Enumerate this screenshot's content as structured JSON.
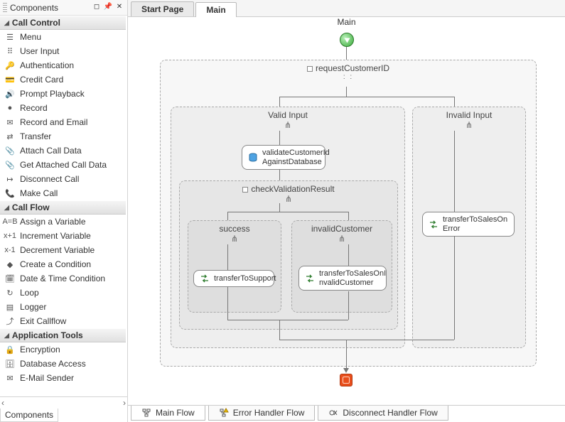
{
  "sidebar": {
    "title": "Components",
    "bottom_tab": "Components",
    "sections": [
      {
        "label": "Call Control",
        "items": [
          {
            "label": "Menu",
            "icon": "menu-icon"
          },
          {
            "label": "User Input",
            "icon": "user-input-icon"
          },
          {
            "label": "Authentication",
            "icon": "auth-icon"
          },
          {
            "label": "Credit Card",
            "icon": "credit-card-icon"
          },
          {
            "label": "Prompt Playback",
            "icon": "speaker-icon"
          },
          {
            "label": "Record",
            "icon": "record-icon"
          },
          {
            "label": "Record and Email",
            "icon": "record-email-icon"
          },
          {
            "label": "Transfer",
            "icon": "transfer-icon"
          },
          {
            "label": "Attach Call Data",
            "icon": "attach-icon"
          },
          {
            "label": "Get Attached Call Data",
            "icon": "get-attached-icon"
          },
          {
            "label": "Disconnect Call",
            "icon": "disconnect-icon"
          },
          {
            "label": "Make Call",
            "icon": "make-call-icon"
          }
        ]
      },
      {
        "label": "Call Flow",
        "items": [
          {
            "label": "Assign a Variable",
            "icon": "assign-icon"
          },
          {
            "label": "Increment Variable",
            "icon": "increment-icon"
          },
          {
            "label": "Decrement Variable",
            "icon": "decrement-icon"
          },
          {
            "label": "Create a Condition",
            "icon": "condition-icon"
          },
          {
            "label": "Date & Time Condition",
            "icon": "datetime-icon"
          },
          {
            "label": "Loop",
            "icon": "loop-icon"
          },
          {
            "label": "Logger",
            "icon": "logger-icon"
          },
          {
            "label": "Exit Callflow",
            "icon": "exit-icon"
          }
        ]
      },
      {
        "label": "Application Tools",
        "items": [
          {
            "label": "Encryption",
            "icon": "encryption-icon"
          },
          {
            "label": "Database Access",
            "icon": "database-icon"
          },
          {
            "label": "E-Mail Sender",
            "icon": "email-icon"
          }
        ]
      }
    ]
  },
  "tabs": {
    "start": "Start Page",
    "main": "Main"
  },
  "diagram": {
    "title": "Main",
    "request": {
      "label": "requestCustomerID"
    },
    "valid": {
      "label": "Valid Input"
    },
    "invalid": {
      "label": "Invalid Input"
    },
    "validateNode": "validateCustomerId\nAgainstDatabase",
    "check": {
      "label": "checkValidationResult"
    },
    "success": {
      "label": "success"
    },
    "invalidCustomer": {
      "label": "invalidCustomer"
    },
    "transferToSupport": "transferToSupport",
    "transferInvalid": "transferToSalesOnI\nnvalidCustomer",
    "transferError": "transferToSalesOn\nError"
  },
  "flow_tabs": {
    "main": "Main Flow",
    "error": "Error Handler Flow",
    "disconnect": "Disconnect Handler Flow"
  }
}
